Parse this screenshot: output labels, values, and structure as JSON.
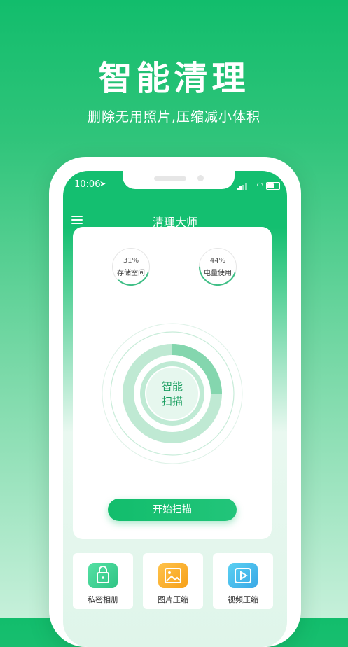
{
  "hero": {
    "title": "智能清理",
    "subtitle": "删除无用照片,压缩减小体积"
  },
  "status": {
    "time": "10:06"
  },
  "nav": {
    "title": "清理大师"
  },
  "stats": [
    {
      "value": "31%",
      "label": "存储空间",
      "percent": 0.31
    },
    {
      "value": "44%",
      "label": "电量使用",
      "percent": 0.44
    }
  ],
  "scan": {
    "center_label_line1": "智能",
    "center_label_line2": "扫描",
    "progress": 0.25,
    "button": "开始扫描"
  },
  "tiles": [
    {
      "label": "私密相册",
      "icon": "lock-icon"
    },
    {
      "label": "图片压缩",
      "icon": "image-icon"
    },
    {
      "label": "视频压缩",
      "icon": "play-icon"
    }
  ],
  "colors": {
    "accent": "#12bd6c"
  }
}
